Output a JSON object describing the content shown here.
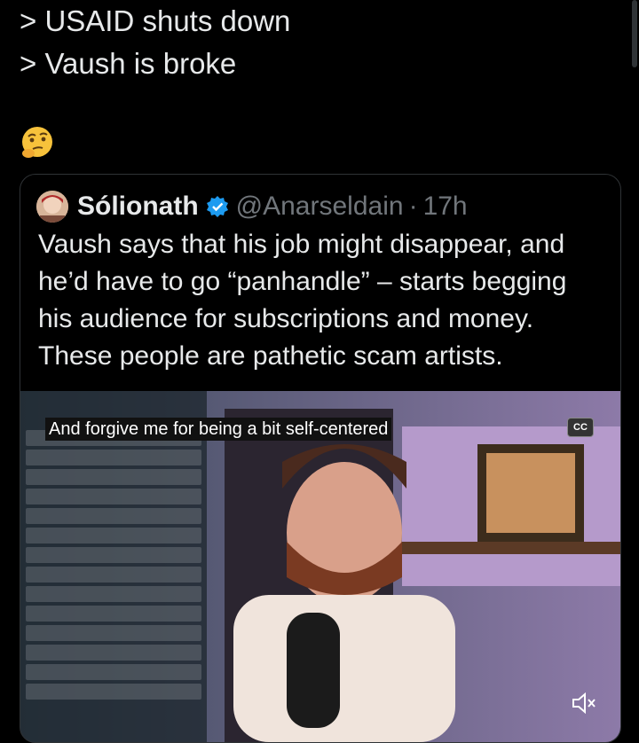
{
  "tweet": {
    "lines": [
      "> USAID shuts down",
      "> Vaush is broke"
    ],
    "emoji": "thinking-face-emoji"
  },
  "quote": {
    "display_name": "Sólionath",
    "handle": "@Anarseldain",
    "separator": "·",
    "time": "17h",
    "body_lines": [
      "Vaush says that his job might disappear, and",
      "he’d have to go “panhandle” – starts begging",
      "his audience for subscriptions and money.",
      "These people are pathetic scam artists."
    ],
    "video": {
      "caption": "And forgive me for being a bit self-centered",
      "cc_label": "CC"
    }
  },
  "colors": {
    "background": "#000000",
    "text": "#e7e9ea",
    "muted": "#71767b",
    "verified": "#1d9bf0"
  }
}
